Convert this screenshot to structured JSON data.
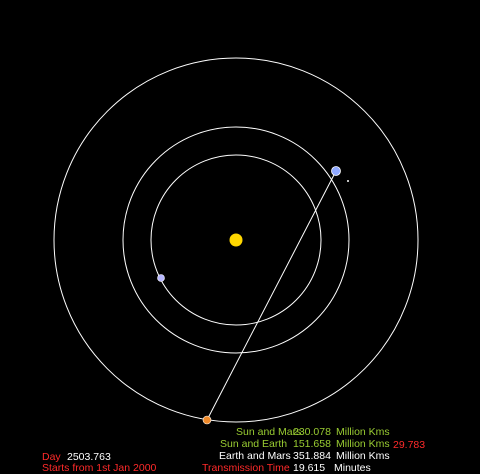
{
  "readouts": {
    "sun_mars": {
      "label": "Sun and Mars",
      "value": "230.078",
      "unit": "Million Kms"
    },
    "sun_earth": {
      "label": "Sun and Earth",
      "value": "151.658",
      "unit": "Million Kms"
    },
    "earth_mars": {
      "label": "Earth and Mars",
      "value": "351.884",
      "unit": "Million Kms"
    },
    "transmission": {
      "label": "Transmission Time",
      "value": "19.615",
      "unit": "Minutes"
    },
    "side_value": "29.783"
  },
  "day": {
    "label": "Day",
    "value": "2503.763",
    "note": "Starts from 1st Jan 2000"
  },
  "colors": {
    "background": "#000000",
    "orbit": "#ffffff",
    "sun": "#ffd700",
    "mars": "#f08a2a",
    "earth": "#8fa8ff",
    "venus": "#b7b7ff",
    "label_green": "#9acd32",
    "label_red": "#ff2a2a"
  }
}
